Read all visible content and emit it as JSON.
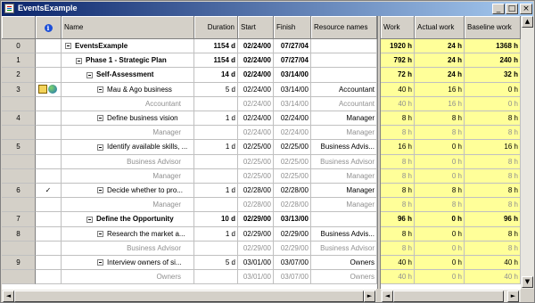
{
  "window": {
    "title": "EventsExample",
    "min_glyph": "_",
    "max_glyph": "□",
    "close_glyph": "×"
  },
  "headers": {
    "id": "",
    "info": "i",
    "name": "Name",
    "duration": "Duration",
    "start": "Start",
    "finish": "Finish",
    "resource": "Resource names",
    "work": "Work",
    "actual_work": "Actual work",
    "baseline_work": "Baseline work"
  },
  "rows": [
    {
      "id": "0",
      "ind": "",
      "name": "EventsExample",
      "level": 0,
      "toggle": true,
      "bold": true,
      "gray": false,
      "duration": "1154 d",
      "start": "02/24/00",
      "finish": "07/27/04",
      "resource": "",
      "work": "1920 h",
      "actual": "24 h",
      "baseline": "1368 h"
    },
    {
      "id": "1",
      "ind": "",
      "name": "Phase 1 - Strategic Plan",
      "level": 1,
      "toggle": true,
      "bold": true,
      "gray": false,
      "duration": "1154 d",
      "start": "02/24/00",
      "finish": "07/27/04",
      "resource": "",
      "work": "792 h",
      "actual": "24 h",
      "baseline": "240 h"
    },
    {
      "id": "2",
      "ind": "",
      "name": "Self-Assessment",
      "level": 2,
      "toggle": true,
      "bold": true,
      "gray": false,
      "duration": "14 d",
      "start": "02/24/00",
      "finish": "03/14/00",
      "resource": "",
      "work": "72 h",
      "actual": "24 h",
      "baseline": "32 h"
    },
    {
      "id": "3",
      "ind": "notes",
      "name": "Mau & Ago business",
      "level": 3,
      "toggle": true,
      "bold": false,
      "gray": false,
      "duration": "5 d",
      "start": "02/24/00",
      "finish": "03/14/00",
      "resource": "Accountant",
      "work": "40 h",
      "actual": "16 h",
      "baseline": "0 h"
    },
    {
      "id": "",
      "ind": "",
      "name": "Accountant",
      "level": 4,
      "toggle": false,
      "bold": false,
      "gray": true,
      "duration": "",
      "start": "02/24/00",
      "finish": "03/14/00",
      "resource": "Accountant",
      "work": "40 h",
      "actual": "16 h",
      "baseline": "0 h"
    },
    {
      "id": "4",
      "ind": "",
      "name": "Define business vision",
      "level": 3,
      "toggle": true,
      "bold": false,
      "gray": false,
      "duration": "1 d",
      "start": "02/24/00",
      "finish": "02/24/00",
      "resource": "Manager",
      "work": "8 h",
      "actual": "8 h",
      "baseline": "8 h"
    },
    {
      "id": "",
      "ind": "",
      "name": "Manager",
      "level": 4,
      "toggle": false,
      "bold": false,
      "gray": true,
      "duration": "",
      "start": "02/24/00",
      "finish": "02/24/00",
      "resource": "Manager",
      "work": "8 h",
      "actual": "8 h",
      "baseline": "8 h"
    },
    {
      "id": "5",
      "ind": "",
      "name": "Identify available skills, ...",
      "level": 3,
      "toggle": true,
      "bold": false,
      "gray": false,
      "duration": "1 d",
      "start": "02/25/00",
      "finish": "02/25/00",
      "resource": "Business Advis...",
      "work": "16 h",
      "actual": "0 h",
      "baseline": "16 h"
    },
    {
      "id": "",
      "ind": "",
      "name": "Business Advisor",
      "level": 4,
      "toggle": false,
      "bold": false,
      "gray": true,
      "duration": "",
      "start": "02/25/00",
      "finish": "02/25/00",
      "resource": "Business Advisor",
      "work": "8 h",
      "actual": "0 h",
      "baseline": "8 h"
    },
    {
      "id": "",
      "ind": "",
      "name": "Manager",
      "level": 4,
      "toggle": false,
      "bold": false,
      "gray": true,
      "duration": "",
      "start": "02/25/00",
      "finish": "02/25/00",
      "resource": "Manager",
      "work": "8 h",
      "actual": "0 h",
      "baseline": "8 h"
    },
    {
      "id": "6",
      "ind": "check",
      "name": "Decide whether to pro...",
      "level": 3,
      "toggle": true,
      "bold": false,
      "gray": false,
      "duration": "1 d",
      "start": "02/28/00",
      "finish": "02/28/00",
      "resource": "Manager",
      "work": "8 h",
      "actual": "8 h",
      "baseline": "8 h"
    },
    {
      "id": "",
      "ind": "",
      "name": "Manager",
      "level": 4,
      "toggle": false,
      "bold": false,
      "gray": true,
      "duration": "",
      "start": "02/28/00",
      "finish": "02/28/00",
      "resource": "Manager",
      "work": "8 h",
      "actual": "8 h",
      "baseline": "8 h"
    },
    {
      "id": "7",
      "ind": "",
      "name": "Define the Opportunity",
      "level": 2,
      "toggle": true,
      "bold": true,
      "gray": false,
      "duration": "10 d",
      "start": "02/29/00",
      "finish": "03/13/00",
      "resource": "",
      "work": "96 h",
      "actual": "0 h",
      "baseline": "96 h"
    },
    {
      "id": "8",
      "ind": "",
      "name": "Research the market a...",
      "level": 3,
      "toggle": true,
      "bold": false,
      "gray": false,
      "duration": "1 d",
      "start": "02/29/00",
      "finish": "02/29/00",
      "resource": "Business Advis...",
      "work": "8 h",
      "actual": "0 h",
      "baseline": "8 h"
    },
    {
      "id": "",
      "ind": "",
      "name": "Business Advisor",
      "level": 4,
      "toggle": false,
      "bold": false,
      "gray": true,
      "duration": "",
      "start": "02/29/00",
      "finish": "02/29/00",
      "resource": "Business Advisor",
      "work": "8 h",
      "actual": "0 h",
      "baseline": "8 h"
    },
    {
      "id": "9",
      "ind": "",
      "name": "Interview owners of si...",
      "level": 3,
      "toggle": true,
      "bold": false,
      "gray": false,
      "duration": "5 d",
      "start": "03/01/00",
      "finish": "03/07/00",
      "resource": "Owners",
      "work": "40 h",
      "actual": "0 h",
      "baseline": "40 h"
    },
    {
      "id": "",
      "ind": "",
      "name": "Owners",
      "level": 4,
      "toggle": false,
      "bold": false,
      "gray": true,
      "duration": "",
      "start": "03/01/00",
      "finish": "03/07/00",
      "resource": "Owners",
      "work": "40 h",
      "actual": "0 h",
      "baseline": "40 h"
    }
  ],
  "icons": {
    "check_glyph": "✓",
    "scroll_left": "◄",
    "scroll_right": "►",
    "scroll_up": "▲",
    "scroll_down": "▼"
  },
  "colors": {
    "title_start": "#0a246a",
    "title_end": "#a6caf0",
    "work_highlight": "#ffff99",
    "info_icon": "#1d4fd8"
  }
}
